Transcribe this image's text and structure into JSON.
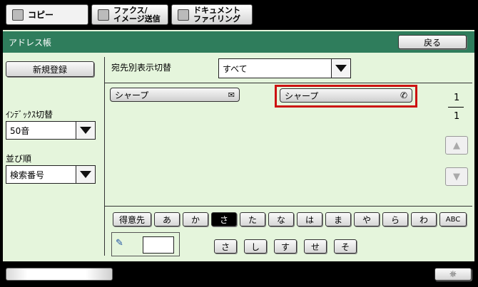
{
  "tabs": [
    {
      "label": "コピー",
      "active": true
    },
    {
      "label": "ファクス/\nイメージ送信",
      "active": false
    },
    {
      "label": "ドキュメント\nファイリング",
      "active": false
    }
  ],
  "panel": {
    "title": "アドレス帳",
    "back_label": "戻る"
  },
  "left": {
    "new_register_label": "新規登録",
    "index_label": "ｲﾝﾃﾞｯｸｽ切替",
    "index_value": "50音",
    "order_label": "並び順",
    "order_value": "検索番号"
  },
  "filter": {
    "label": "宛先別表示切替",
    "value": "すべて"
  },
  "entries": [
    {
      "name": "シャープ",
      "icon": "email-icon"
    },
    {
      "name": "シャープ",
      "icon": "phone-icon",
      "highlighted": true
    }
  ],
  "pager": {
    "current": "1",
    "total": "1"
  },
  "kana_tabs": [
    "得意先",
    "あ",
    "か",
    "さ",
    "た",
    "な",
    "は",
    "ま",
    "や",
    "ら",
    "わ",
    "ABC"
  ],
  "kana_selected": "さ",
  "sub_keys": [
    "さ",
    "し",
    "す",
    "せ",
    "そ"
  ],
  "colors": {
    "highlight": "#cc1111",
    "titlebar": "#2f7d5c",
    "panel": "#e5f5dc"
  }
}
